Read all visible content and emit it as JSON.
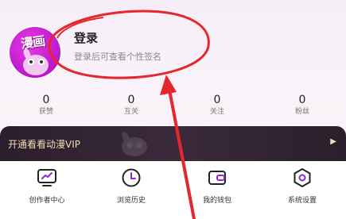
{
  "profile": {
    "avatar_text": "漫画",
    "login_title": "登录",
    "login_subtitle": "登录后可查看个性签名"
  },
  "stats": [
    {
      "value": "0",
      "label": "获赞"
    },
    {
      "value": "0",
      "label": "互关"
    },
    {
      "value": "0",
      "label": "关注"
    },
    {
      "value": "0",
      "label": "粉丝"
    }
  ],
  "vip": {
    "text": "开通看看动漫VIP",
    "arrow": "▶"
  },
  "shortcuts": [
    {
      "label": "创作者中心",
      "icon": "creator-monitor-icon"
    },
    {
      "label": "浏览历史",
      "icon": "clock-icon"
    },
    {
      "label": "我的钱包",
      "icon": "wallet-icon"
    },
    {
      "label": "系统设置",
      "icon": "settings-hexagon-icon"
    }
  ],
  "annotation": {
    "color": "#e5272d",
    "shape": "ellipse-and-arrow"
  },
  "colors": {
    "accent_purple": "#8b2ad6",
    "vip_gold": "#f4dcb3",
    "vip_bg": "#2b1e2b"
  }
}
